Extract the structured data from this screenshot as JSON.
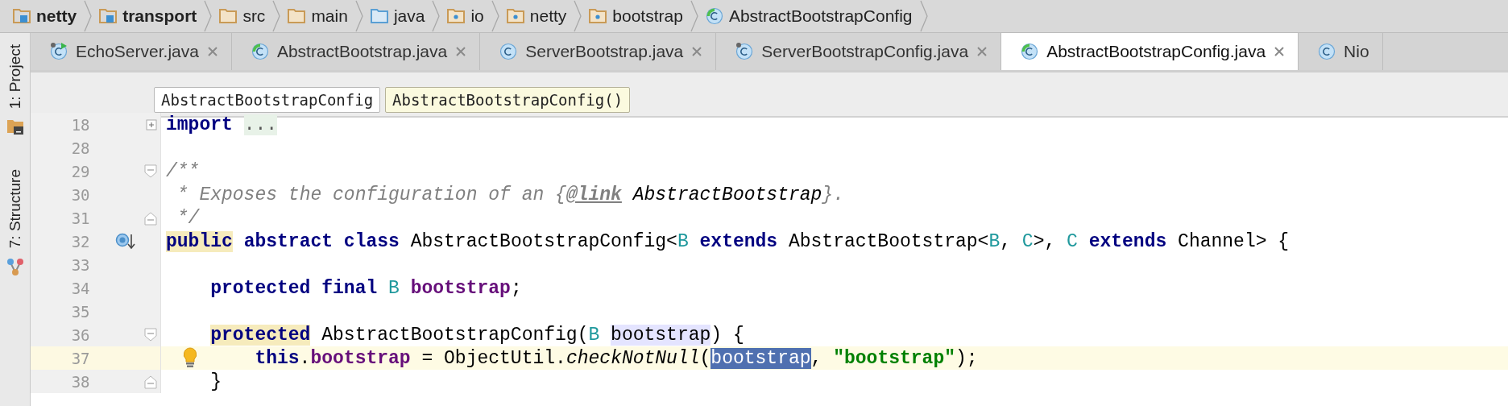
{
  "breadcrumbs": [
    {
      "label": "netty",
      "kind": "module"
    },
    {
      "label": "transport",
      "kind": "module"
    },
    {
      "label": "src",
      "kind": "folder"
    },
    {
      "label": "main",
      "kind": "folder"
    },
    {
      "label": "java",
      "kind": "source"
    },
    {
      "label": "io",
      "kind": "package"
    },
    {
      "label": "netty",
      "kind": "package"
    },
    {
      "label": "bootstrap",
      "kind": "package"
    },
    {
      "label": "AbstractBootstrapConfig",
      "kind": "abstract"
    }
  ],
  "tool_strip": [
    {
      "label": "1: Project",
      "kind": "project"
    },
    {
      "label": "7: Structure",
      "kind": "structure"
    }
  ],
  "tabs": [
    {
      "label": "EchoServer.java",
      "kind": "runnable",
      "selected": false,
      "closable": true
    },
    {
      "label": "AbstractBootstrap.java",
      "kind": "abstract",
      "selected": false,
      "closable": true
    },
    {
      "label": "ServerBootstrap.java",
      "kind": "class",
      "selected": false,
      "closable": true
    },
    {
      "label": "ServerBootstrapConfig.java",
      "kind": "pinned",
      "selected": false,
      "closable": true
    },
    {
      "label": "AbstractBootstrapConfig.java",
      "kind": "abstract",
      "selected": true,
      "closable": true
    },
    {
      "label": "Nio",
      "kind": "class",
      "selected": false,
      "closable": false
    }
  ],
  "structure_path": [
    {
      "label": "AbstractBootstrapConfig",
      "selected": false
    },
    {
      "label": "AbstractBootstrapConfig()",
      "selected": true
    }
  ],
  "code_lines": [
    {
      "number": "18",
      "folded": true,
      "current": false,
      "tokens": [
        {
          "text": "import",
          "kind": "keyword"
        },
        {
          "text": "...",
          "kind": "folded",
          "space_before": true
        }
      ]
    },
    {
      "number": "28",
      "current": false
    },
    {
      "number": "29",
      "fold_start": true,
      "current": false,
      "tokens": [
        {
          "text": "/**",
          "kind": "comment"
        }
      ]
    },
    {
      "number": "30",
      "current": false,
      "tokens": [
        {
          "text": " * Exposes the configuration of an {",
          "kind": "comment"
        },
        {
          "text": "@link",
          "kind": "doctag"
        },
        {
          "text": "AbstractBootstrap",
          "kind": "docref",
          "space_before": true
        },
        {
          "text": "}.",
          "kind": "comment"
        }
      ]
    },
    {
      "number": "31",
      "fold_end": true,
      "current": false,
      "tokens": [
        {
          "text": " */",
          "kind": "comment"
        }
      ]
    },
    {
      "number": "32",
      "implementations": true,
      "current": false,
      "tokens": [
        {
          "text": "public",
          "kind": "keyword",
          "usage_highlight": true
        },
        {
          "text": "abstract",
          "kind": "keyword",
          "space_before": true
        },
        {
          "text": "class",
          "kind": "keyword",
          "space_before": true
        },
        {
          "text": "AbstractBootstrapConfig<",
          "kind": "plain",
          "space_before": true
        },
        {
          "text": "B",
          "kind": "typeparam"
        },
        {
          "text": "extends",
          "kind": "keyword",
          "space_before": true
        },
        {
          "text": "AbstractBootstrap<",
          "kind": "plain",
          "space_before": true
        },
        {
          "text": "B",
          "kind": "typeparam"
        },
        {
          "text": ",",
          "kind": "plain"
        },
        {
          "text": "C",
          "kind": "typeparam",
          "space_before": true
        },
        {
          "text": ">,",
          "kind": "plain"
        },
        {
          "text": "C",
          "kind": "typeparam",
          "space_before": true
        },
        {
          "text": "extends",
          "kind": "keyword",
          "space_before": true
        },
        {
          "text": "Channel> {",
          "kind": "plain",
          "space_before": true
        }
      ],
      "children": [
        {
          "number": "33",
          "current": false
        },
        {
          "number": "34",
          "current": false,
          "tokens": [
            {
              "text": "protected",
              "kind": "keyword"
            },
            {
              "text": "final",
              "kind": "keyword",
              "space_before": true
            },
            {
              "text": "B",
              "kind": "typeparam",
              "space_before": true
            },
            {
              "text": "bootstrap",
              "kind": "field",
              "space_before": true
            },
            {
              "text": ";",
              "kind": "plain"
            }
          ]
        },
        {
          "number": "35",
          "current": false
        },
        {
          "number": "36",
          "fold_start": true,
          "current": false,
          "tokens": [
            {
              "text": "protected",
              "kind": "keyword",
              "usage_highlight": true
            },
            {
              "text": "AbstractBootstrapConfig(",
              "kind": "plain",
              "space_before": true
            },
            {
              "text": "B",
              "kind": "typeparam"
            },
            {
              "text": "bootstrap",
              "kind": "plain",
              "read_highlight": true,
              "space_before": true
            },
            {
              "text": ") {",
              "kind": "plain"
            }
          ],
          "children": [
            {
              "number": "37",
              "bulb": true,
              "current": true,
              "tokens": [
                {
                  "text": "this",
                  "kind": "keyword"
                },
                {
                  "text": ".",
                  "kind": "plain"
                },
                {
                  "text": "bootstrap",
                  "kind": "field"
                },
                {
                  "text": "= ObjectUtil.",
                  "kind": "plain",
                  "space_before": true
                },
                {
                  "text": "checkNotNull",
                  "kind": "static"
                },
                {
                  "text": "(",
                  "kind": "plain"
                },
                {
                  "text": "bootstrap",
                  "kind": "plain",
                  "selected": true
                },
                {
                  "text": ",",
                  "kind": "plain"
                },
                {
                  "text": "\"bootstrap\"",
                  "kind": "string",
                  "space_before": true
                },
                {
                  "text": ");",
                  "kind": "plain"
                }
              ]
            }
          ]
        },
        {
          "number": "38",
          "fold_end": true,
          "current": false,
          "tokens": [
            {
              "text": "}",
              "kind": "plain"
            }
          ]
        }
      ]
    }
  ]
}
